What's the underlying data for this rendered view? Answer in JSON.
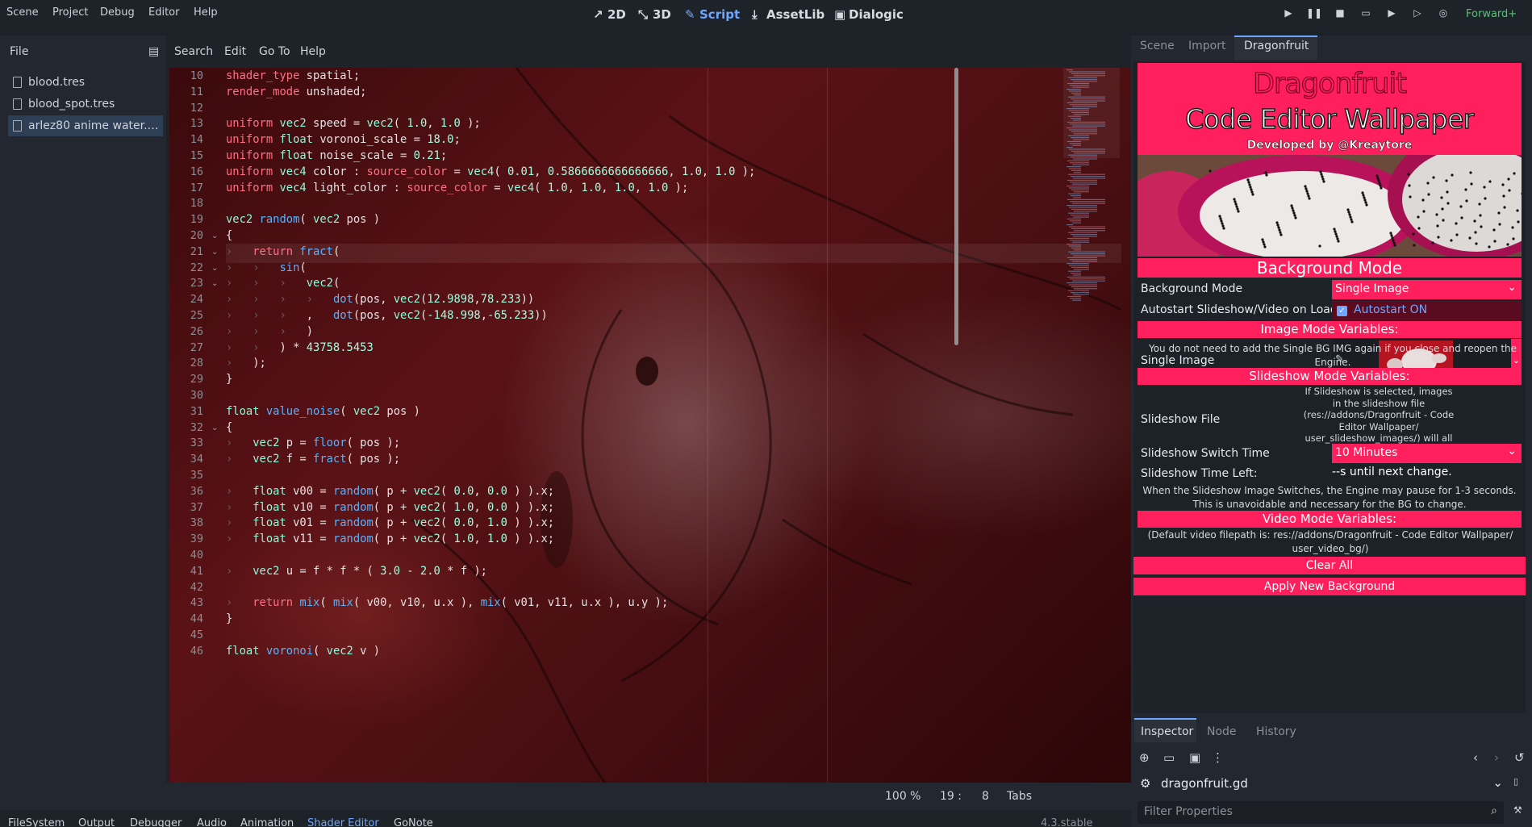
{
  "menu": [
    "Scene",
    "Project",
    "Debug",
    "Editor",
    "Help"
  ],
  "workspaces": [
    {
      "label": "2D",
      "icon": "pen-icon"
    },
    {
      "label": "3D",
      "icon": "transform-icon"
    },
    {
      "label": "Script",
      "icon": "script-icon",
      "active": true
    },
    {
      "label": "AssetLib",
      "icon": "download-icon"
    },
    {
      "label": "Dialogic",
      "icon": "dialog-icon"
    }
  ],
  "renderer": "Forward+",
  "file_panel": {
    "menus": [
      "File",
      "Search",
      "Edit",
      "Go To",
      "Help"
    ],
    "scripts": [
      "blood.tres",
      "blood_spot.tres",
      "arlez80 anime water.g..."
    ]
  },
  "code_lines": [
    {
      "n": "10",
      "text": "shader_type spatial;"
    },
    {
      "n": "11",
      "text": "render_mode unshaded;"
    },
    {
      "n": "12",
      "text": ""
    },
    {
      "n": "13",
      "text": "uniform vec2 speed = vec2( 1.0, 1.0 );"
    },
    {
      "n": "14",
      "text": "uniform float voronoi_scale = 18.0;"
    },
    {
      "n": "15",
      "text": "uniform float noise_scale = 0.21;"
    },
    {
      "n": "16",
      "text": "uniform vec4 color : source_color = vec4( 0.01, 0.5866666666666666, 1.0, 1.0 );"
    },
    {
      "n": "17",
      "text": "uniform vec4 light_color : source_color = vec4( 1.0, 1.0, 1.0, 1.0 );"
    },
    {
      "n": "18",
      "text": ""
    },
    {
      "n": "19",
      "text": "vec2 random( vec2 pos )"
    },
    {
      "n": "20",
      "text": "{"
    },
    {
      "n": "21",
      "text": "    return fract("
    },
    {
      "n": "22",
      "text": "        sin("
    },
    {
      "n": "23",
      "text": "            vec2("
    },
    {
      "n": "24",
      "text": "                dot(pos, vec2(12.9898,78.233))"
    },
    {
      "n": "25",
      "text": "            ,   dot(pos, vec2(-148.998,-65.233))"
    },
    {
      "n": "26",
      "text": "            )"
    },
    {
      "n": "27",
      "text": "        ) * 43758.5453"
    },
    {
      "n": "28",
      "text": "    );"
    },
    {
      "n": "29",
      "text": "}"
    },
    {
      "n": "30",
      "text": ""
    },
    {
      "n": "31",
      "text": "float value_noise( vec2 pos )"
    },
    {
      "n": "32",
      "text": "{"
    },
    {
      "n": "33",
      "text": "    vec2 p = floor( pos );"
    },
    {
      "n": "34",
      "text": "    vec2 f = fract( pos );"
    },
    {
      "n": "35",
      "text": ""
    },
    {
      "n": "36",
      "text": "    float v00 = random( p + vec2( 0.0, 0.0 ) ).x;"
    },
    {
      "n": "37",
      "text": "    float v10 = random( p + vec2( 1.0, 0.0 ) ).x;"
    },
    {
      "n": "38",
      "text": "    float v01 = random( p + vec2( 0.0, 1.0 ) ).x;"
    },
    {
      "n": "39",
      "text": "    float v11 = random( p + vec2( 1.0, 1.0 ) ).x;"
    },
    {
      "n": "40",
      "text": ""
    },
    {
      "n": "41",
      "text": "    vec2 u = f * f * ( 3.0 - 2.0 * f );"
    },
    {
      "n": "42",
      "text": ""
    },
    {
      "n": "43",
      "text": "    return mix( mix( v00, v10, u.x ), mix( v01, v11, u.x ), u.y );"
    },
    {
      "n": "44",
      "text": "}"
    },
    {
      "n": "45",
      "text": ""
    },
    {
      "n": "46",
      "text": "float voronoi( vec2 v )"
    }
  ],
  "editor_status": {
    "zoom": "100 %",
    "line": "19 :",
    "col": "8",
    "indent": "Tabs"
  },
  "bottom_tabs": [
    "FileSystem",
    "Output",
    "Debugger",
    "Audio",
    "Animation",
    "Shader Editor",
    "GoNote"
  ],
  "version": "4.3.stable",
  "dock_tabs": [
    "Scene",
    "Import",
    "Dragonfruit"
  ],
  "dragonfruit": {
    "title1": "Dragonfruit",
    "title2": "Code Editor Wallpaper",
    "developer": "Developed by @Kreaytore",
    "background_mode_heading": "Background Mode",
    "background_mode_label": "Background Mode",
    "background_mode_value": "Single Image",
    "autostart_label": "Autostart Slideshow/Video on Load",
    "autostart_value": "Autostart ON",
    "image_vars_heading": "Image Mode Variables:",
    "single_image_label": "Single Image",
    "single_image_note": "You do not need to add the Single BG IMG again if you close and reopen the Engine.",
    "slideshow_vars_heading": "Slideshow Mode Variables:",
    "slideshow_file_label": "Slideshow File",
    "slideshow_file_note": "If Slideshow is selected, images in the slideshow file (res://addons/Dragonfruit - Code Editor Wallpaper/ user_slideshow_images/) will all be selected.",
    "switch_time_label": "Slideshow Switch Time",
    "switch_time_value": "10 Minutes",
    "time_left_label": "Slideshow Time Left:",
    "time_left_value": "--s until next change.",
    "switch_note": "When the Slideshow Image Switches, the Engine may pause for 1-3 seconds. This is unavoidable and necessary for the BG to change.",
    "video_vars_heading": "Video Mode Variables:",
    "video_note": "(Default video filepath is: res://addons/Dragonfruit - Code Editor Wallpaper/ user_video_bg/)",
    "clear_all": "Clear All",
    "apply": "Apply New Background",
    "colors": {
      "accent": "#ff1f5c"
    }
  },
  "inspector": {
    "tabs": [
      "Inspector",
      "Node",
      "History"
    ],
    "resource": "dragonfruit.gd",
    "filter_placeholder": "Filter Properties"
  }
}
